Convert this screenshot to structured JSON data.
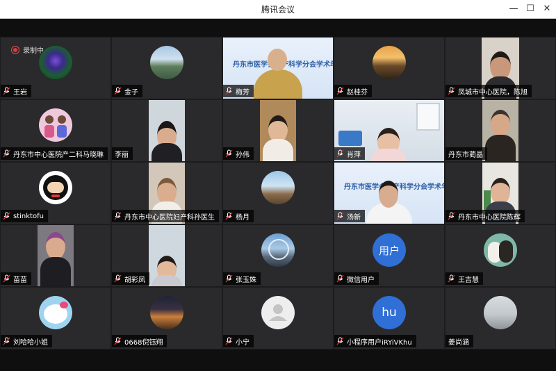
{
  "window": {
    "title": "腾讯会议",
    "minimize": "—",
    "maximize": "☐",
    "close": "✕"
  },
  "recording": {
    "label": "录制中"
  },
  "participants": [
    {
      "name": "王岩"
    },
    {
      "name": "金子"
    },
    {
      "name": "梅芳"
    },
    {
      "name": "赵桂芬"
    },
    {
      "name": "凤城市中心医院，陈旭"
    },
    {
      "name": "丹东市中心医院产二科马晓琳"
    },
    {
      "name": "李丽"
    },
    {
      "name": "孙伟"
    },
    {
      "name": "肖萍"
    },
    {
      "name": "丹东市蔺晶"
    },
    {
      "name": "stinktofu"
    },
    {
      "name": "丹东市中心医院妇产科孙医生"
    },
    {
      "name": "杨月"
    },
    {
      "name": "汤新"
    },
    {
      "name": "丹东市中心医院陈辉"
    },
    {
      "name": "苗苗"
    },
    {
      "name": "胡彩凤"
    },
    {
      "name": "张玉姝"
    },
    {
      "name": "微信用户"
    },
    {
      "name": "王吉慧"
    },
    {
      "name": "刘哈哈小姐"
    },
    {
      "name": "0668倪钰翔"
    },
    {
      "name": "小宁"
    },
    {
      "name": "小程序用户iRYiVKhu"
    },
    {
      "name": "姜尚涵"
    }
  ],
  "avatar_texts": {
    "user": "用户",
    "hu": "hu"
  },
  "banner": {
    "title": "丹东市医学会妇产科学分会学术年会"
  },
  "colors": {
    "tile_bg": "#2a2a2c",
    "avatar_blue": "#2f6fd6",
    "namebar": "#000000"
  }
}
